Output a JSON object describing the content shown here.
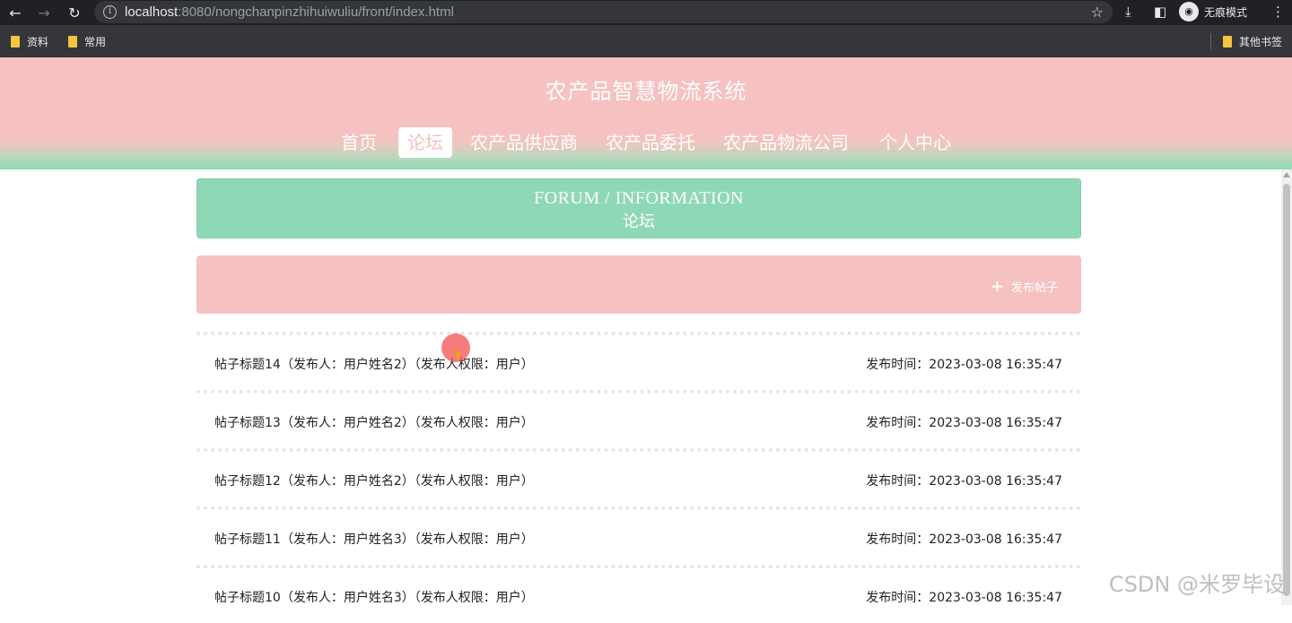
{
  "browser": {
    "url_host": "localhost",
    "url_rest": ":8080/nongchanpinzhihuiwuliu/front/index.html",
    "incognito_label": "无痕模式",
    "bookmarks": [
      "资料",
      "常用"
    ],
    "other_bookmarks": "其他书签"
  },
  "site": {
    "title": "农产品智慧物流系统",
    "nav": [
      "首页",
      "论坛",
      "农产品供应商",
      "农产品委托",
      "农产品物流公司",
      "个人中心"
    ],
    "active_nav": "论坛"
  },
  "banner": {
    "en": "FORUM / INFORMATION",
    "zh": "论坛"
  },
  "actions": {
    "post_label": "发布帖子"
  },
  "posts": [
    {
      "title": "帖子标题14（发布人：用户姓名2）（发布人权限：用户）",
      "time": "发布时间：2023-03-08 16:35:47"
    },
    {
      "title": "帖子标题13（发布人：用户姓名2）（发布人权限：用户）",
      "time": "发布时间：2023-03-08 16:35:47"
    },
    {
      "title": "帖子标题12（发布人：用户姓名2）（发布人权限：用户）",
      "time": "发布时间：2023-03-08 16:35:47"
    },
    {
      "title": "帖子标题11（发布人：用户姓名3）（发布人权限：用户）",
      "time": "发布时间：2023-03-08 16:35:47"
    },
    {
      "title": "帖子标题10（发布人：用户姓名3）（发布人权限：用户）",
      "time": "发布时间：2023-03-08 16:35:47"
    }
  ],
  "watermark": "CSDN @米罗毕设",
  "colors": {
    "pink": "#f6c1c1",
    "mint": "#8fd8b6"
  }
}
